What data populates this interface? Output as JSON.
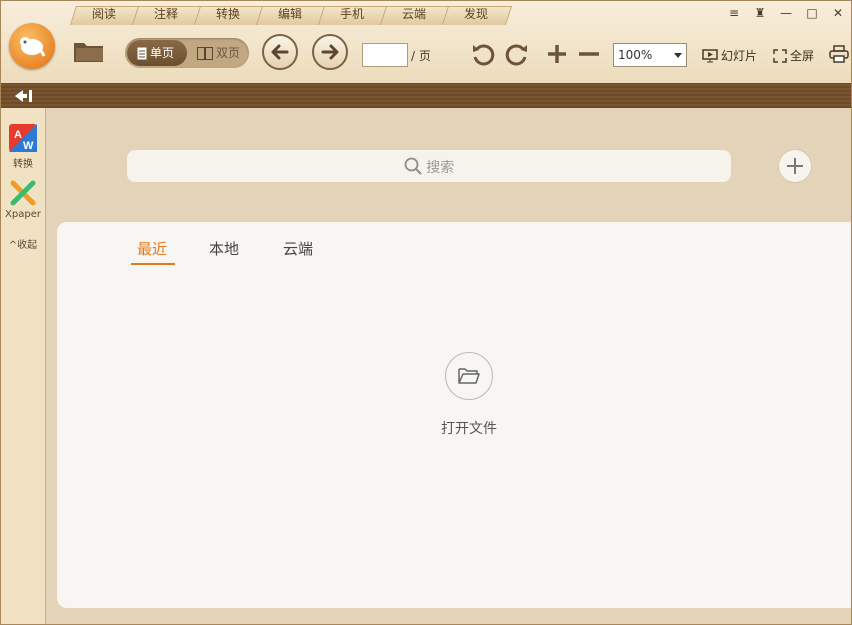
{
  "tabs": [
    "阅读",
    "注释",
    "转换",
    "编辑",
    "手机",
    "云端",
    "发现"
  ],
  "toolbar": {
    "single_page": "单页",
    "double_page": "双页",
    "page_input_value": "",
    "page_separator": "/ 页",
    "zoom": "100%",
    "slideshow": "幻灯片",
    "fullscreen": "全屏"
  },
  "window_buttons": [
    "filter-icon",
    "skin-icon",
    "minimize-icon",
    "maximize-icon",
    "close-icon"
  ],
  "sidebar": {
    "items": [
      {
        "label": "转换",
        "icon": "pdf-to-word-icon"
      },
      {
        "label": "Xpaper",
        "icon": "xpaper-icon"
      }
    ],
    "collapse": "^收起"
  },
  "main": {
    "search_placeholder": "搜索",
    "file_tabs": [
      "最近",
      "本地",
      "云端"
    ],
    "active_file_tab": "最近",
    "open_file": "打开文件"
  },
  "colors": {
    "accent": "#e37b1d",
    "wood": "#6e4b28",
    "toolbar": "#f3e6cc"
  }
}
